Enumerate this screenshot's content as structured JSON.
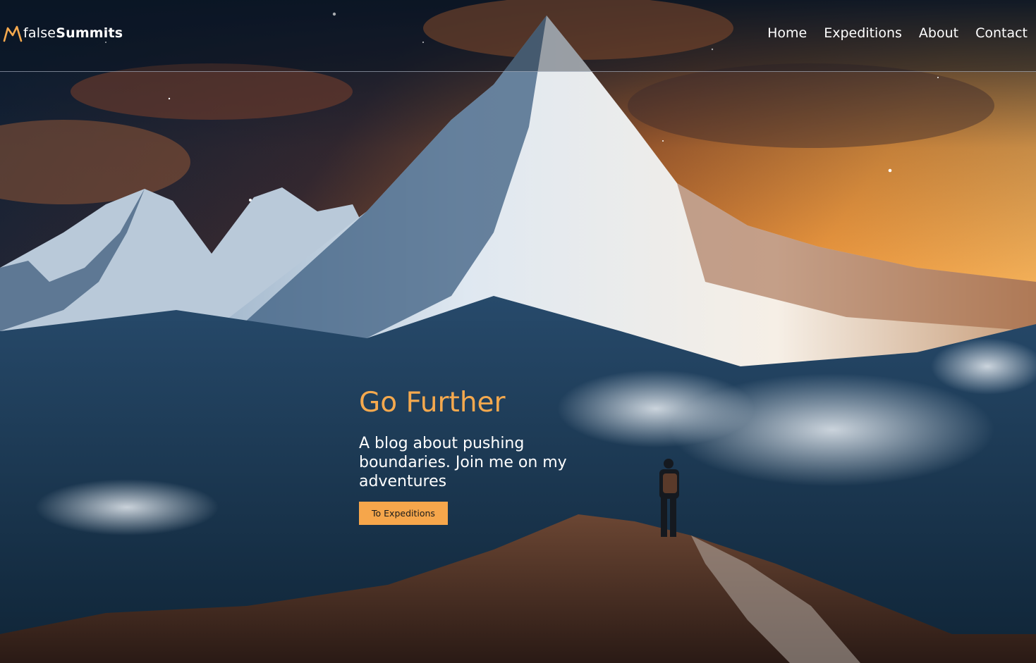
{
  "brand": {
    "name_light": "false",
    "name_bold": "Summits",
    "icon": "mountain-peak-icon",
    "accent_color": "#f5a94e"
  },
  "nav": {
    "items": [
      {
        "label": "Home"
      },
      {
        "label": "Expeditions"
      },
      {
        "label": "About"
      },
      {
        "label": "Contact"
      }
    ]
  },
  "hero": {
    "title": "Go Further",
    "subtitle": "A blog about pushing boundaries. Join me on my adventures",
    "cta_label": "To Expeditions",
    "cta_color": "#f6a64b",
    "background": "mountain-summit-hiker-image"
  }
}
